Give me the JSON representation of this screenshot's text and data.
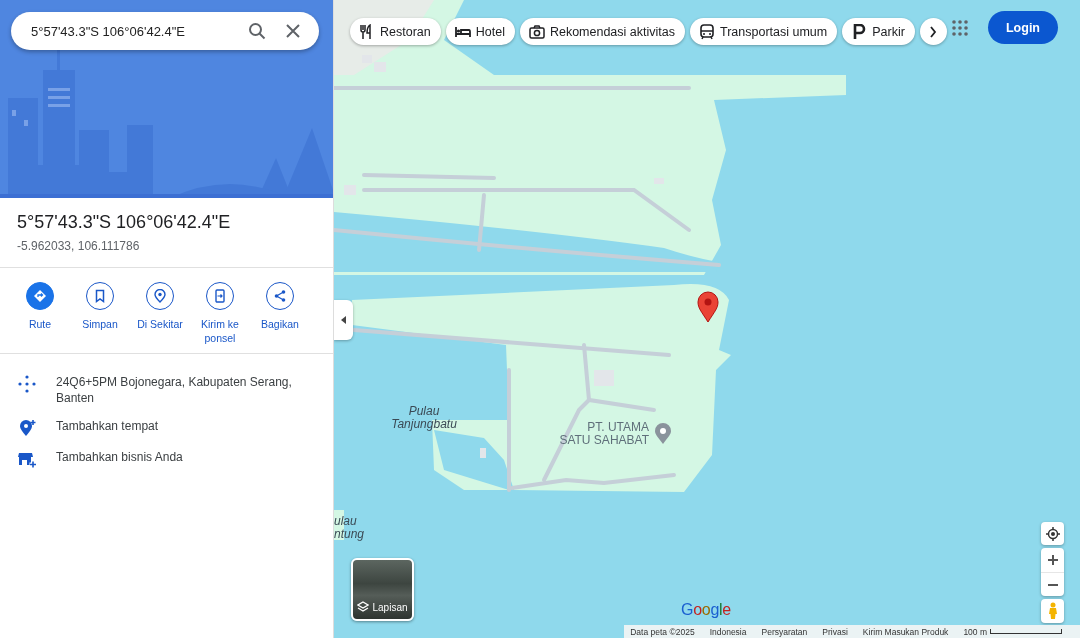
{
  "search": {
    "value": "5°57'43.3\"S 106°06'42.4\"E"
  },
  "place": {
    "title": "5°57'43.3\"S 106°06'42.4\"E",
    "coordinates": "-5.962033, 106.111786"
  },
  "actions": [
    {
      "label": "Rute",
      "kind": "route",
      "primary": true
    },
    {
      "label": "Simpan",
      "kind": "save",
      "primary": false
    },
    {
      "label": "Di Sekitar",
      "kind": "nearby",
      "primary": false
    },
    {
      "label": "Kirim ke ponsel",
      "kind": "phone",
      "primary": false
    },
    {
      "label": "Bagikan",
      "kind": "share",
      "primary": false
    }
  ],
  "info_rows": [
    {
      "text": "24Q6+5PM Bojonegara, Kabupaten Serang, Banten",
      "kind": "plus-code"
    },
    {
      "text": "Tambahkan tempat",
      "kind": "add-place"
    },
    {
      "text": "Tambahkan bisnis Anda",
      "kind": "add-business"
    }
  ],
  "chips": [
    {
      "label": "Restoran",
      "kind": "restaurant"
    },
    {
      "label": "Hotel",
      "kind": "hotel"
    },
    {
      "label": "Rekomendasi aktivitas",
      "kind": "camera"
    },
    {
      "label": "Transportasi umum",
      "kind": "transit"
    },
    {
      "label": "Parkir",
      "kind": "parking"
    }
  ],
  "login": "Login",
  "map_labels": [
    {
      "text": "Pulau Tanjungbatu",
      "kind": "island"
    },
    {
      "text": "PT. UTAMA SATU SAHABAT",
      "kind": "poi"
    },
    {
      "text": "ulau ntung",
      "kind": "island-cut"
    }
  ],
  "layers": {
    "label": "Lapisan"
  },
  "logo": "Google",
  "footer": [
    "Data peta ©2025",
    "Indonesia",
    "Persyaratan",
    "Privasi",
    "Kirim Masukan Produk"
  ],
  "scale": "100 m"
}
